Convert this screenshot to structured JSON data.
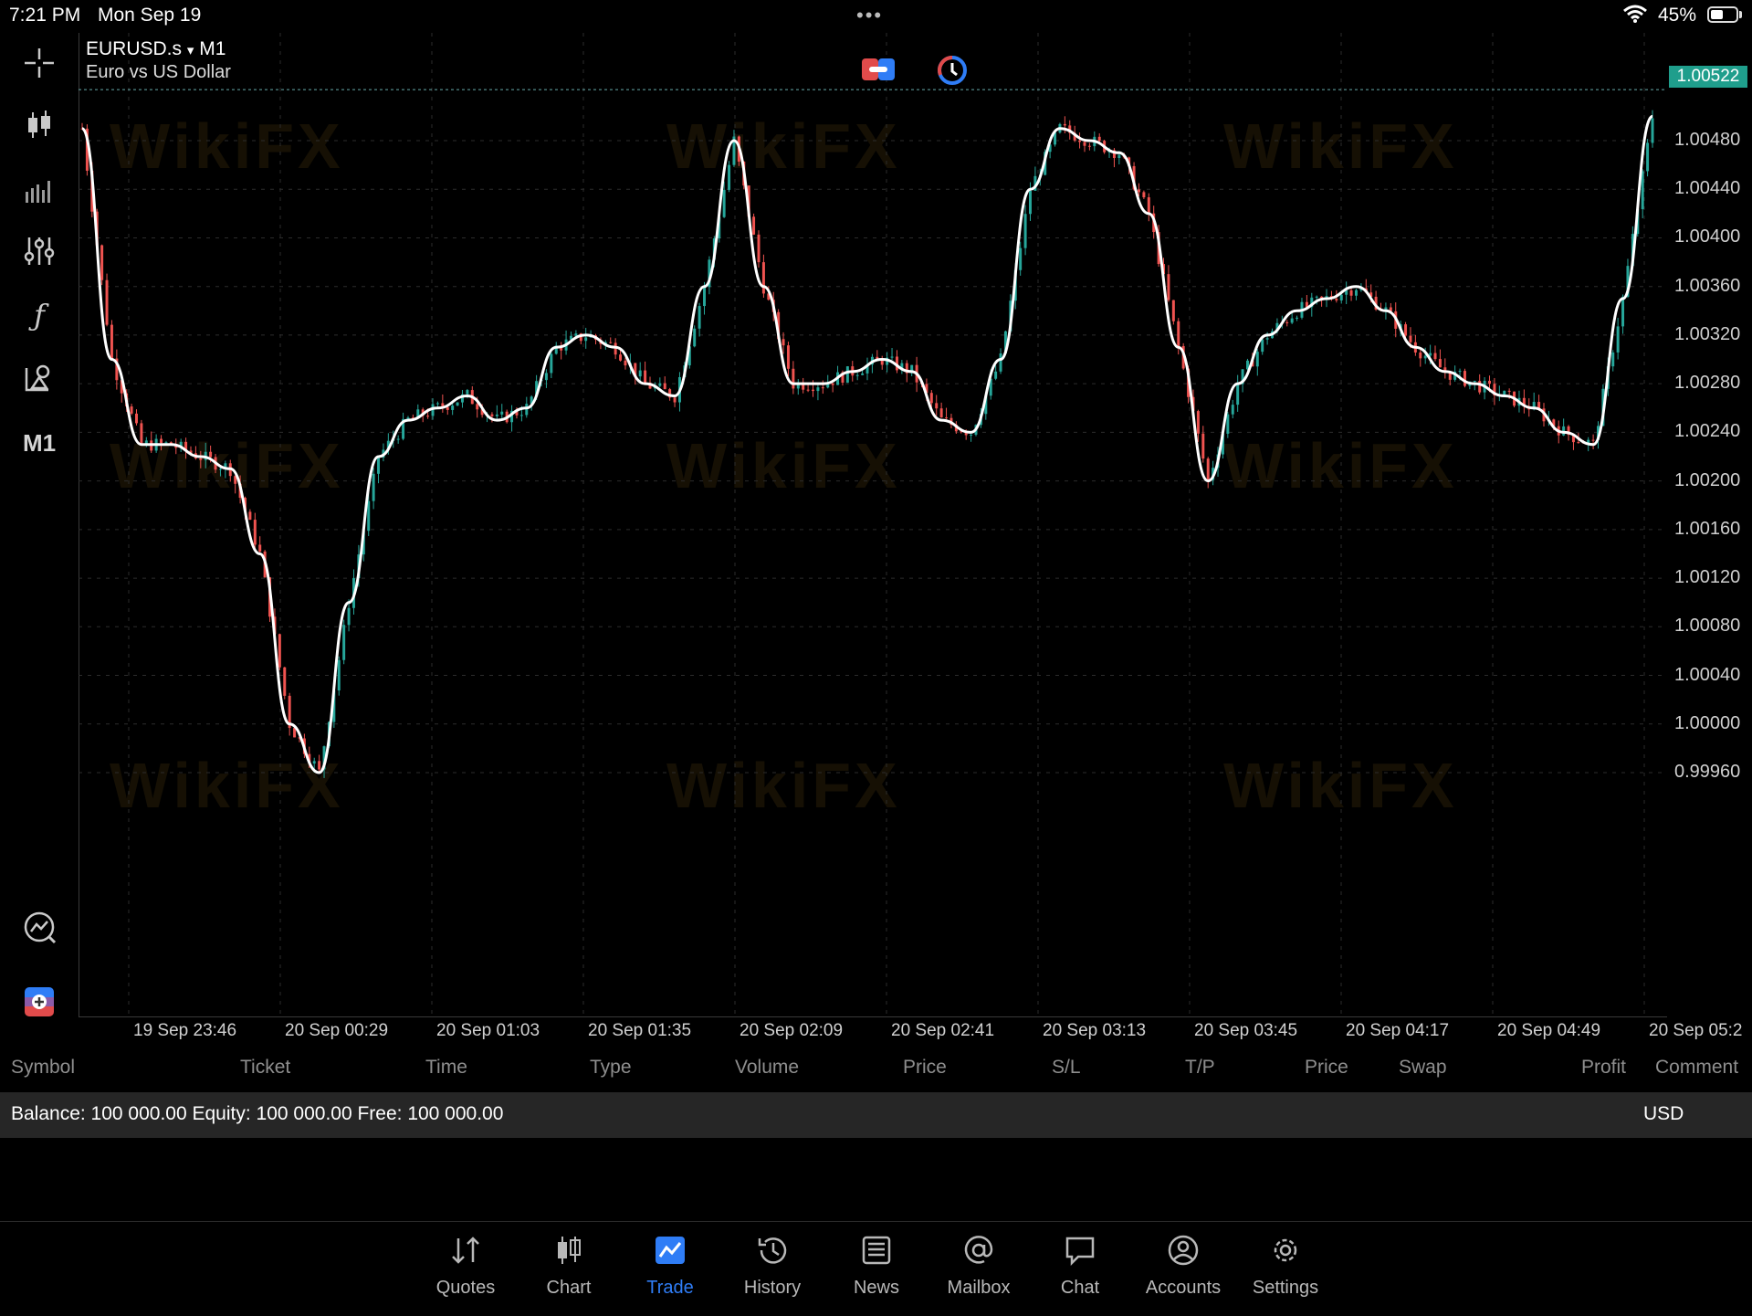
{
  "status_bar": {
    "time": "7:21 PM",
    "date": "Mon Sep 19",
    "battery": "45%",
    "multitask_dots": "•••"
  },
  "toolbar": {
    "timeframe": "M1",
    "icons": [
      "crosshair-icon",
      "candles-icon",
      "volume-bars-icon",
      "indicators-sliders-icon",
      "function-icon",
      "objects-icon",
      "timeframe-label",
      "chart-check-icon",
      "trade-add-icon"
    ]
  },
  "chart": {
    "symbol": "EURUSD.s",
    "dropdown": "▾",
    "timeframe": "M1",
    "description": "Euro vs US Dollar",
    "current_price": "1.00522",
    "colors": {
      "bull": "#26a69a",
      "bear": "#ef5350",
      "ma": "#ffffff",
      "grid": "#2c2c2c",
      "price_tag": "#1f9e8c"
    },
    "y_ticks": [
      "1.00480",
      "1.00440",
      "1.00400",
      "1.00360",
      "1.00320",
      "1.00280",
      "1.00240",
      "1.00200",
      "1.00160",
      "1.00120",
      "1.00080",
      "1.00040",
      "1.00000",
      "0.99960"
    ],
    "x_ticks": [
      "19 Sep 23:46",
      "20 Sep 00:29",
      "20 Sep 01:03",
      "20 Sep 01:35",
      "20 Sep 02:09",
      "20 Sep 02:41",
      "20 Sep 03:13",
      "20 Sep 03:45",
      "20 Sep 04:17",
      "20 Sep 04:49",
      "20 Sep 05:2"
    ]
  },
  "chart_data": {
    "type": "line",
    "title": "EURUSD.s M1",
    "ylim": [
      0.9993,
      1.0054
    ],
    "x_ticks": [
      "19 Sep 23:46",
      "20 Sep 00:29",
      "20 Sep 01:03",
      "20 Sep 01:35",
      "20 Sep 02:09",
      "20 Sep 02:41",
      "20 Sep 03:13",
      "20 Sep 03:45",
      "20 Sep 04:17",
      "20 Sep 04:49",
      "20 Sep 05:2"
    ],
    "series": [
      {
        "values": [
          1.0049,
          1.003,
          1.0023,
          1.0023,
          1.0022,
          1.0021,
          1.0014,
          1.0,
          0.9996,
          1.001,
          1.0022,
          1.0025,
          1.0026,
          1.0027,
          1.0025,
          1.0026,
          1.0031,
          1.0032,
          1.0031,
          1.0028,
          1.0027,
          1.0036,
          1.0048,
          1.0036,
          1.0028,
          1.0028,
          1.0029,
          1.003,
          1.0029,
          1.0025,
          1.0024,
          1.003,
          1.0044,
          1.0049,
          1.0048,
          1.0047,
          1.0042,
          1.0031,
          1.002,
          1.0028,
          1.0032,
          1.0034,
          1.0035,
          1.0036,
          1.0034,
          1.0031,
          1.0029,
          1.0028,
          1.0027,
          1.0026,
          1.0024,
          1.0023,
          1.0035,
          1.005
        ]
      }
    ]
  },
  "trade_table": {
    "columns": [
      "Symbol",
      "Ticket",
      "Time",
      "Type",
      "Volume",
      "Price",
      "S/L",
      "T/P",
      "Price",
      "Swap",
      "Profit",
      "Comment"
    ],
    "balance_line": "Balance: 100 000.00 Equity: 100 000.00 Free: 100 000.00",
    "currency": "USD"
  },
  "tabs": [
    {
      "label": "Quotes",
      "icon": "quotes-icon"
    },
    {
      "label": "Chart",
      "icon": "chart-candles-icon"
    },
    {
      "label": "Trade",
      "icon": "trade-icon",
      "active": true
    },
    {
      "label": "History",
      "icon": "history-icon"
    },
    {
      "label": "News",
      "icon": "news-icon"
    },
    {
      "label": "Mailbox",
      "icon": "mailbox-icon"
    },
    {
      "label": "Chat",
      "icon": "chat-icon"
    },
    {
      "label": "Accounts",
      "icon": "accounts-icon"
    },
    {
      "label": "Settings",
      "icon": "settings-icon"
    }
  ],
  "watermark": "WikiFX"
}
